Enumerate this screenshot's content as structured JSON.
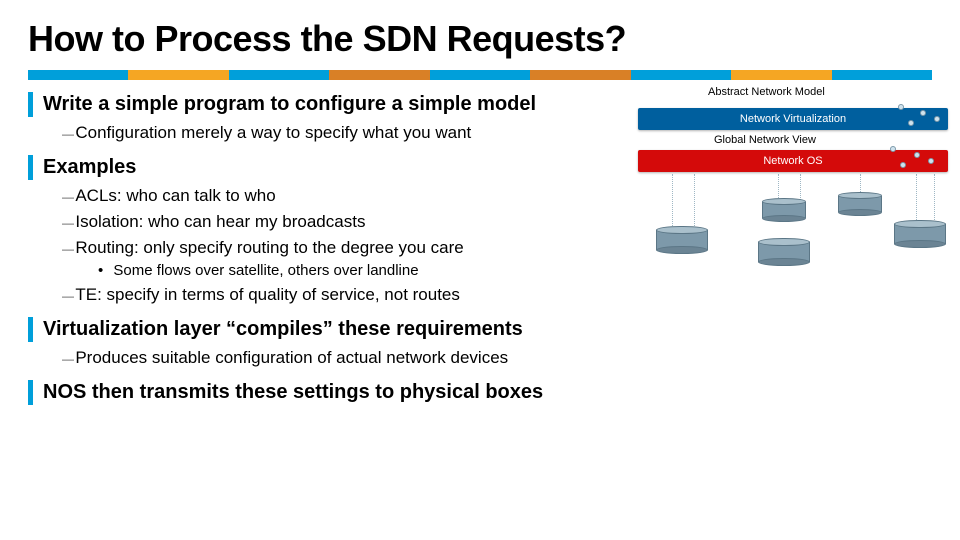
{
  "title": "How to Process the SDN Requests?",
  "stripe_colors": [
    "#009fda",
    "#f5a623",
    "#009fda",
    "#d98026",
    "#009fda",
    "#d98026",
    "#009fda",
    "#f5a623",
    "#009fda"
  ],
  "sections": {
    "s1": {
      "heading": "Write a simple program to configure a simple model",
      "items": [
        "Configuration merely a way to specify what you want"
      ]
    },
    "s2": {
      "heading": "Examples",
      "items": [
        "ACLs: who can talk to who",
        "Isolation: who can hear my broadcasts",
        "Routing: only specify routing to the degree you care"
      ],
      "subitem": "Some flows over satellite, others over landline",
      "item_after": "TE: specify in terms of quality of service, not routes"
    },
    "s3": {
      "heading": "Virtualization layer “compiles” these requirements",
      "items": [
        "Produces suitable configuration of actual network devices"
      ]
    },
    "s4": {
      "heading": "NOS then transmits these settings to physical boxes"
    }
  },
  "diagram": {
    "abstract_label": "Abstract Network Model",
    "virtualization_label": "Network Virtualization",
    "global_view_label": "Global Network View",
    "nos_label": "Network OS"
  }
}
